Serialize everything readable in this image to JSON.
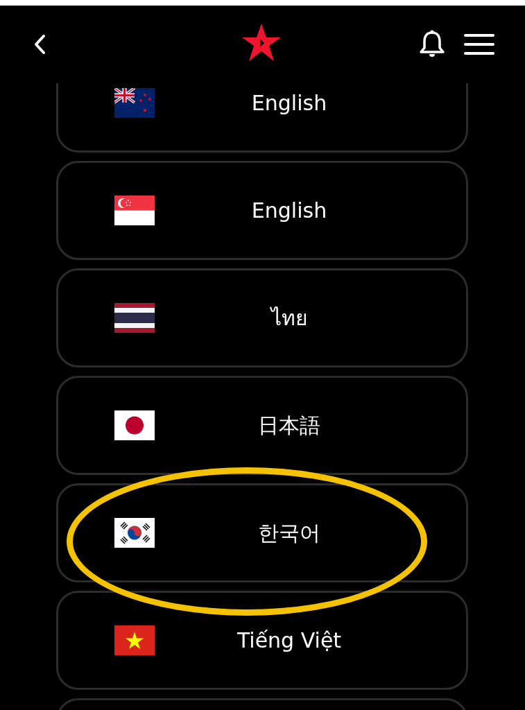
{
  "languages": [
    {
      "label": "English",
      "kind": "newzealand",
      "highlighted": false
    },
    {
      "label": "English",
      "kind": "singapore",
      "highlighted": false
    },
    {
      "label": "ไทย",
      "kind": "thailand",
      "highlighted": false
    },
    {
      "label": "日本語",
      "kind": "japan",
      "highlighted": false
    },
    {
      "label": "한국어",
      "kind": "korea",
      "highlighted": true
    },
    {
      "label": "Tiếng Việt",
      "kind": "vietnam",
      "highlighted": false
    }
  ]
}
